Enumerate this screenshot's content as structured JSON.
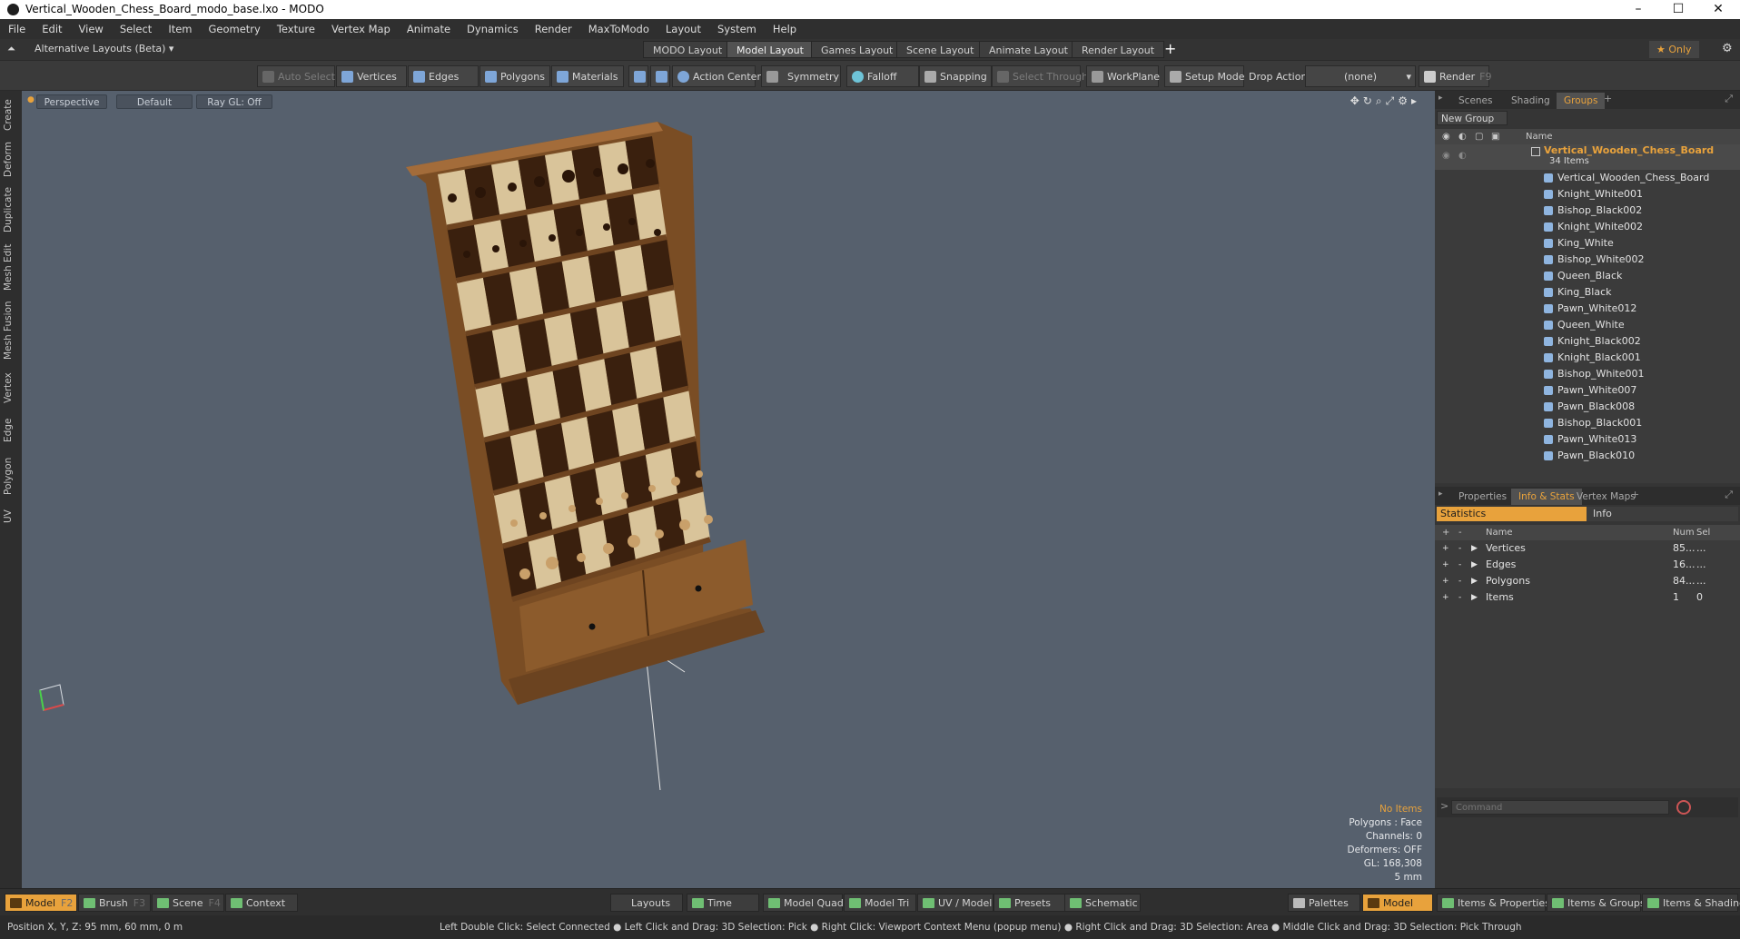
{
  "window": {
    "title": "Vertical_Wooden_Chess_Board_modo_base.lxo - MODO",
    "min": "–",
    "max": "☐",
    "close": "✕"
  },
  "menu": [
    "File",
    "Edit",
    "View",
    "Select",
    "Item",
    "Geometry",
    "Texture",
    "Vertex Map",
    "Animate",
    "Dynamics",
    "Render",
    "MaxToModo",
    "Layout",
    "System",
    "Help"
  ],
  "layoutbar": {
    "alt_layouts": "Alternative Layouts (Beta) ▾",
    "tabs": [
      "MODO Layout",
      "Model Layout",
      "Games Layout",
      "Scene Layout",
      "Animate Layout",
      "Render Layout"
    ],
    "active_tab": "Model Layout",
    "add": "+",
    "only": "★  Only",
    "gear": "⚙"
  },
  "toolbar": {
    "auto_select": "Auto Select",
    "vertices": "Vertices",
    "edges": "Edges",
    "polygons": "Polygons",
    "materials": "Materials",
    "action_center": "Action Center",
    "symmetry": "Symmetry",
    "falloff": "Falloff",
    "snapping": "Snapping",
    "select_through": "Select Through",
    "workplane": "WorkPlane",
    "setup_mode": "Setup Mode",
    "drop_action": "Drop Action",
    "drop_value": "(none)",
    "render": "Render",
    "render_key": "F9"
  },
  "left_tabs": [
    "Create",
    "Deform",
    "Duplicate",
    "Mesh Edit",
    "Mesh Fusion",
    "Vertex",
    "Edge",
    "Polygon",
    "UV"
  ],
  "viewport": {
    "perspective": "Perspective",
    "default": "Default",
    "raygl": "Ray GL: Off",
    "stats": [
      "No Items",
      "Polygons : Face",
      "Channels: 0",
      "Deformers: OFF",
      "GL: 168,308",
      "5 mm"
    ]
  },
  "groups_panel": {
    "tabs": [
      "Scenes",
      "Shading",
      "Groups"
    ],
    "active": "Groups",
    "new_group": "New Group",
    "col_name": "Name",
    "root_name": "Vertical_Wooden_Chess_Board",
    "root_count": "34 Items",
    "items": [
      "Vertical_Wooden_Chess_Board",
      "Knight_White001",
      "Bishop_Black002",
      "Knight_White002",
      "King_White",
      "Bishop_White002",
      "Queen_Black",
      "King_Black",
      "Pawn_White012",
      "Queen_White",
      "Knight_Black002",
      "Knight_Black001",
      "Bishop_White001",
      "Pawn_White007",
      "Pawn_Black008",
      "Bishop_Black001",
      "Pawn_White013",
      "Pawn_Black010"
    ]
  },
  "info_panel": {
    "tabs": [
      "Properties",
      "Info & Stats",
      "Vertex Maps"
    ],
    "active": "Info & Stats",
    "subtabs": [
      "Statistics",
      "Info"
    ],
    "cols": [
      "Name",
      "Num",
      "Sel"
    ],
    "rows": [
      {
        "name": "Vertices",
        "num": "85...",
        "sel": "..."
      },
      {
        "name": "Edges",
        "num": "16...",
        "sel": "..."
      },
      {
        "name": "Polygons",
        "num": "84...",
        "sel": "..."
      },
      {
        "name": "Items",
        "num": "1",
        "sel": "0"
      }
    ],
    "command_placeholder": "Command"
  },
  "bottombar": {
    "model": "Model",
    "model_key": "F2",
    "brush": "Brush",
    "brush_key": "F3",
    "scene": "Scene",
    "scene_key": "F4",
    "context": "Context",
    "layouts": "Layouts",
    "time": "Time",
    "model_quad": "Model Quad",
    "model_tri": "Model Tri",
    "uv_model": "UV / Model",
    "presets": "Presets",
    "schematic": "Schematic",
    "palettes": "Palettes",
    "model2": "Model",
    "items_props": "Items & Properties",
    "items_groups": "Items & Groups",
    "items_shading": "Items & Shading"
  },
  "status": {
    "position": "Position X, Y, Z:   95 mm, 60 mm, 0 m",
    "hints": "Left Double Click: Select Connected ● Left Click and Drag: 3D Selection: Pick ● Right Click: Viewport Context Menu (popup menu) ● Right Click and Drag: 3D Selection: Area ● Middle Click and Drag: 3D Selection: Pick Through"
  },
  "colors": {
    "accent": "#e8a23c",
    "viewport": "#56606d",
    "wood": "#8a5a2e"
  }
}
